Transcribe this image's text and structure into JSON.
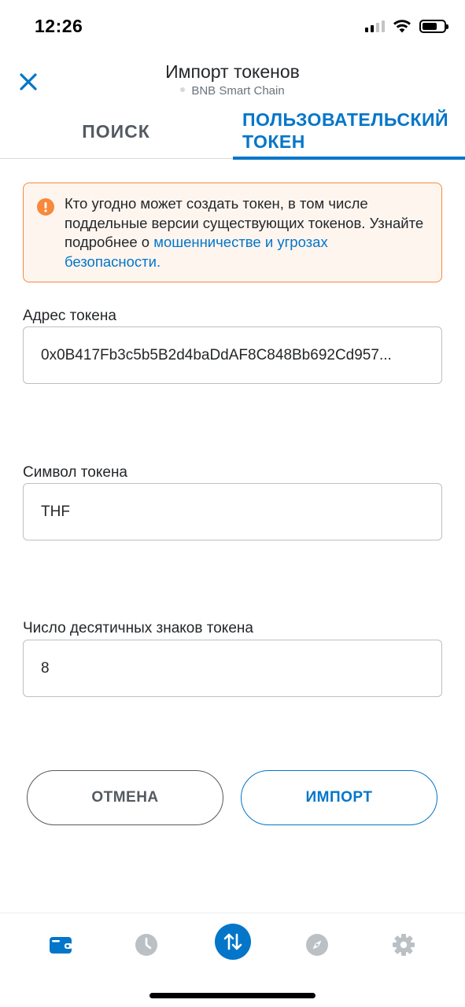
{
  "status_bar": {
    "time": "12:26"
  },
  "header": {
    "title": "Импорт токенов",
    "network": "BNB Smart Chain"
  },
  "tabs": [
    {
      "label": "ПОИСК",
      "active": false
    },
    {
      "label": "ПОЛЬЗОВАТЕЛЬСКИЙ ТОКЕН",
      "active": true
    }
  ],
  "warning": {
    "text": "Кто угодно может создать токен, в том числе поддельные версии существующих токенов. Узнайте подробнее о ",
    "link_text": "мошенничестве и угрозах безопасности",
    "suffix": "."
  },
  "fields": {
    "address": {
      "label": "Адрес токена",
      "value": "0x0B417Fb3c5b5B2d4baDdAF8C848Bb692Cd957..."
    },
    "symbol": {
      "label": "Символ токена",
      "value": "THF"
    },
    "decimals": {
      "label": "Число десятичных знаков токена",
      "value": "8"
    }
  },
  "buttons": {
    "cancel": "ОТМЕНА",
    "import": "ИМПОРТ"
  },
  "bottom_nav": [
    {
      "icon": "wallet-icon",
      "active": true
    },
    {
      "icon": "clock-icon",
      "active": false
    },
    {
      "icon": "swap-arrows-icon",
      "active": false
    },
    {
      "icon": "compass-icon",
      "active": false
    },
    {
      "icon": "gear-icon",
      "active": false
    }
  ],
  "colors": {
    "primary": "#0376c9",
    "warning_border": "#f8883b",
    "warning_bg": "#fef5ef",
    "inactive_icon": "#bbc0c5"
  }
}
